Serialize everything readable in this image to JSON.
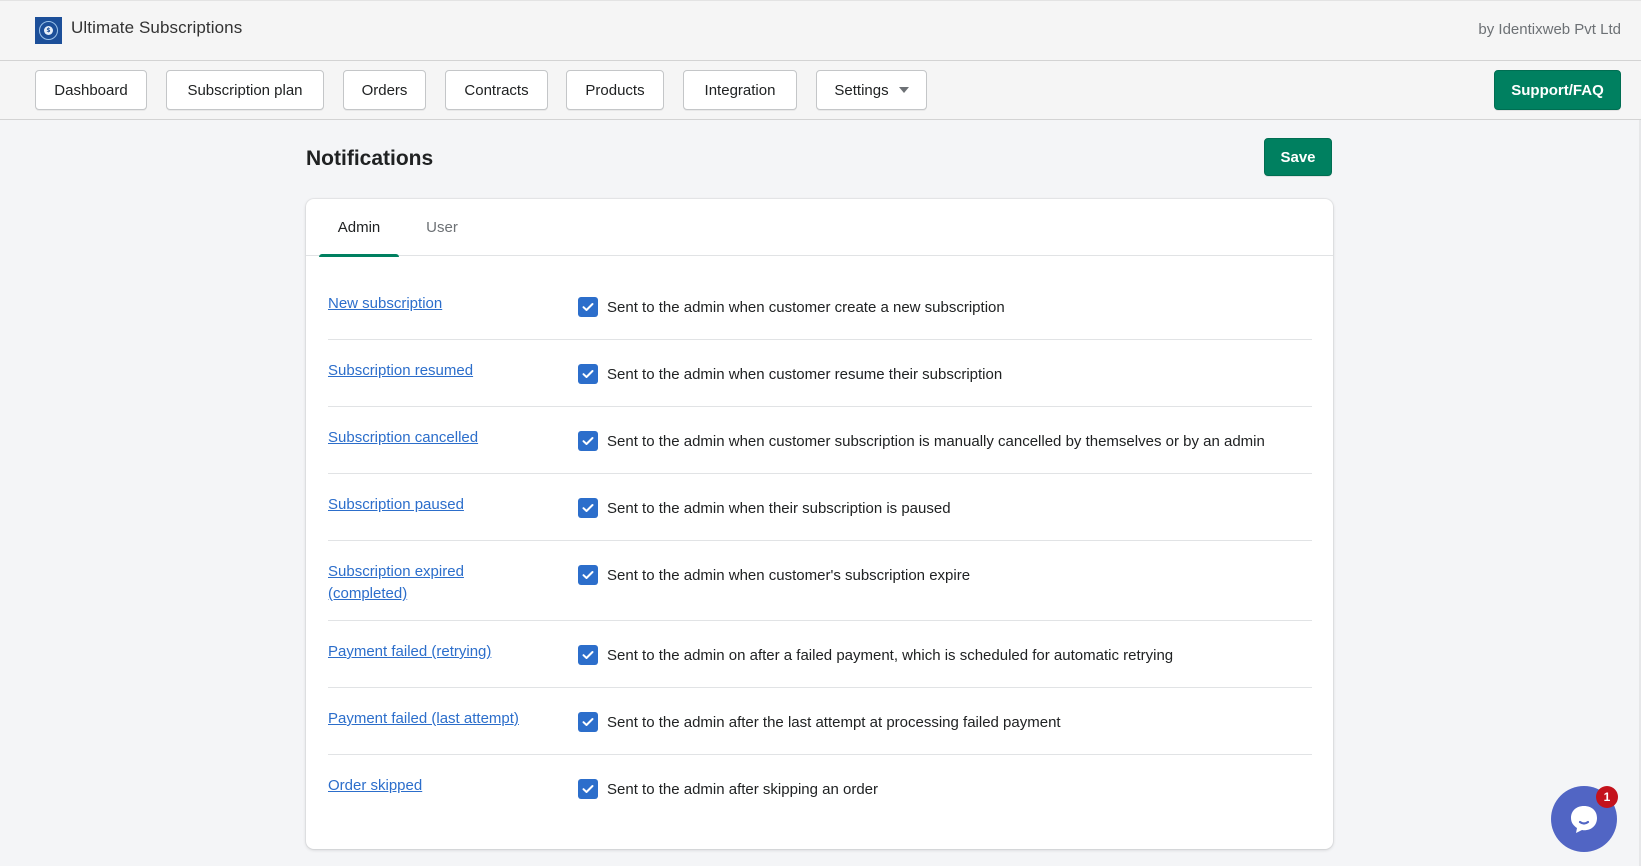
{
  "app": {
    "title": "Ultimate Subscriptions",
    "vendor": "by Identixweb Pvt Ltd",
    "logo_icon": "subscription-logo-icon"
  },
  "nav": {
    "items": [
      {
        "label": "Dashboard"
      },
      {
        "label": "Subscription plan"
      },
      {
        "label": "Orders"
      },
      {
        "label": "Contracts"
      },
      {
        "label": "Products"
      },
      {
        "label": "Integration"
      },
      {
        "label": "Settings",
        "has_dropdown": true
      }
    ],
    "support_label": "Support/FAQ"
  },
  "page": {
    "title": "Notifications",
    "save_label": "Save"
  },
  "tabs": [
    {
      "label": "Admin",
      "active": true
    },
    {
      "label": "User",
      "active": false
    }
  ],
  "notifications": [
    {
      "name": "New subscription",
      "description": "Sent to the admin when customer create a new subscription",
      "checked": true
    },
    {
      "name": "Subscription resumed",
      "description": "Sent to the admin when customer resume their subscription",
      "checked": true
    },
    {
      "name": "Subscription cancelled",
      "description": "Sent to the admin when customer subscription is manually cancelled by themselves or by an admin",
      "checked": true
    },
    {
      "name": "Subscription paused",
      "description": "Sent to the admin when their subscription is paused",
      "checked": true
    },
    {
      "name": "Subscription expired (completed)",
      "description": "Sent to the admin when customer's subscription expire",
      "checked": true
    },
    {
      "name": "Payment failed (retrying)",
      "description": "Sent to the admin on after a failed payment, which is scheduled for automatic retrying",
      "checked": true
    },
    {
      "name": "Payment failed (last attempt)",
      "description": "Sent to the admin after the last attempt at processing failed payment",
      "checked": true
    },
    {
      "name": "Order skipped",
      "description": "Sent to the admin after skipping an order",
      "checked": true
    }
  ],
  "chat": {
    "icon": "chat-bubble-icon",
    "unread_count": "1"
  },
  "colors": {
    "primary": "#008060",
    "link": "#2c6ecb",
    "checkbox": "#2c6ecb",
    "chat": "#5165c4",
    "badge": "#c4121c"
  }
}
